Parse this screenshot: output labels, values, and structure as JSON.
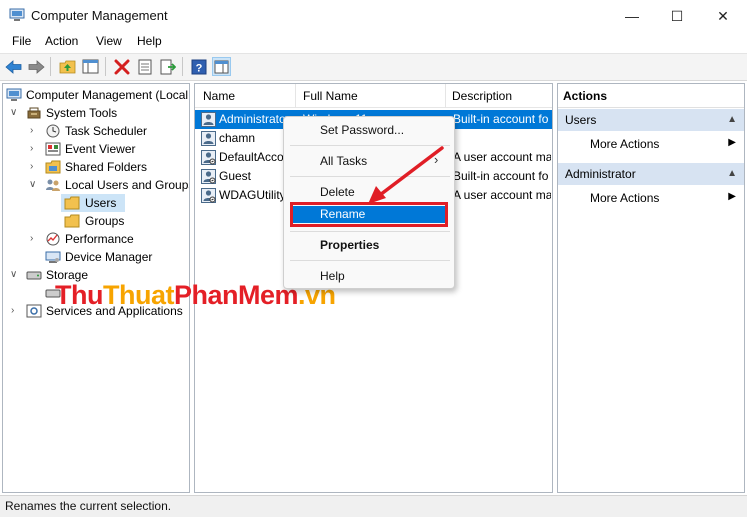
{
  "window": {
    "title": "Computer Management",
    "minimize_glyph": "—",
    "maximize_glyph": "☐",
    "close_glyph": "✕"
  },
  "menu": [
    "File",
    "Action",
    "View",
    "Help"
  ],
  "tree": {
    "root": "Computer Management (Local",
    "system_tools": "System Tools",
    "task_scheduler": "Task Scheduler",
    "event_viewer": "Event Viewer",
    "shared_folders": "Shared Folders",
    "local_users_groups": "Local Users and Groups",
    "users": "Users",
    "groups": "Groups",
    "performance": "Performance",
    "device_manager": "Device Manager",
    "storage": "Storage",
    "services_apps": "Services and Applications"
  },
  "list": {
    "columns": [
      "Name",
      "Full Name",
      "Description"
    ],
    "rows": [
      {
        "name": "Administrator",
        "full_name": "Windows 11",
        "description": "Built-in account fo"
      },
      {
        "name": "chamn",
        "full_name": "",
        "description": ""
      },
      {
        "name": "DefaultAcco",
        "full_name": "",
        "description": "A user account ma"
      },
      {
        "name": "Guest",
        "full_name": "",
        "description": "Built-in account fo"
      },
      {
        "name": "WDAGUtility",
        "full_name": "",
        "description": "A user account ma"
      }
    ]
  },
  "context_menu": {
    "set_password": "Set Password...",
    "all_tasks": "All Tasks",
    "delete": "Delete",
    "rename": "Rename",
    "properties": "Properties",
    "help": "Help"
  },
  "actions": {
    "header": "Actions",
    "section_users": "Users",
    "more_actions_1": "More Actions",
    "section_admin": "Administrator",
    "more_actions_2": "More Actions"
  },
  "status": "Renames the current selection.",
  "watermark": {
    "part1": "Thu",
    "part2": "Thuat",
    "part3": "PhanMem",
    "part4": ".vn"
  },
  "colors": {
    "selection": "#0078d7",
    "highlight_box": "#e01e26",
    "arrow": "#e01e26"
  }
}
